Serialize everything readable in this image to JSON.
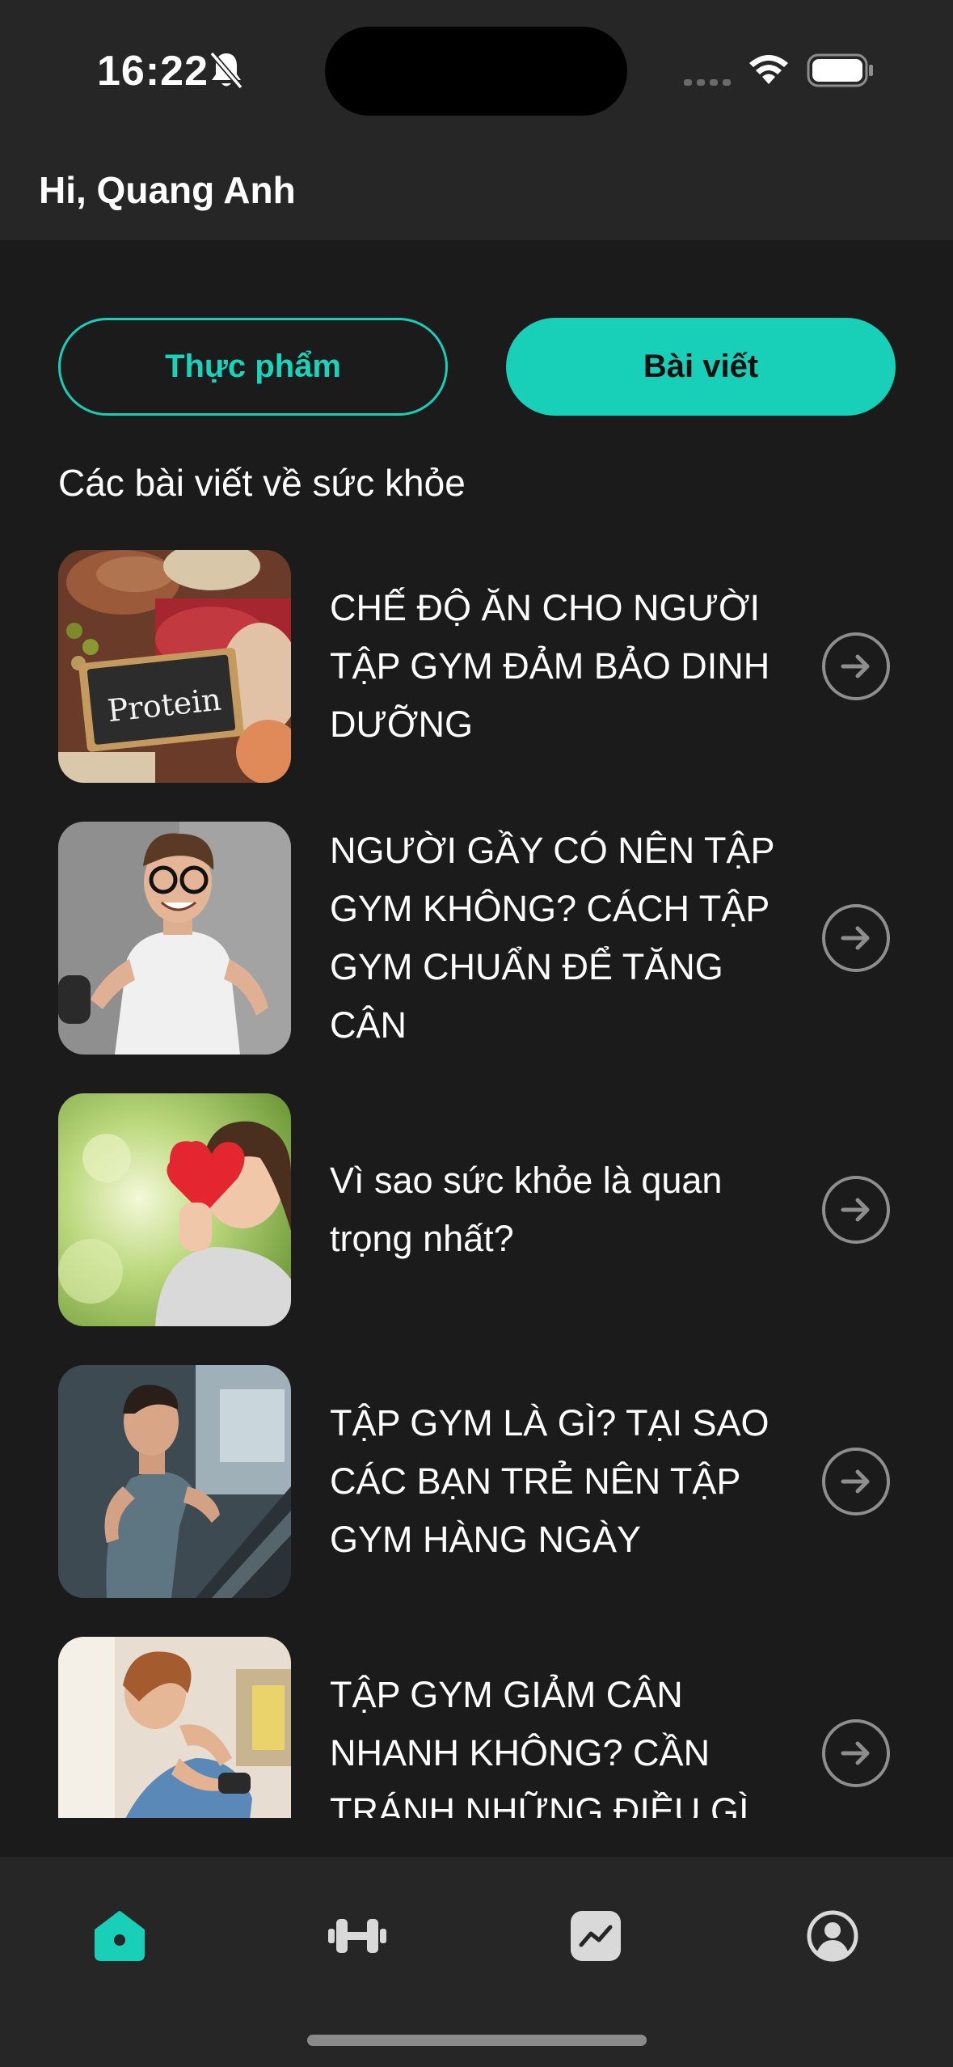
{
  "status_bar": {
    "time": "16:22"
  },
  "header": {
    "greeting": "Hi, Quang Anh"
  },
  "tabs": {
    "food_label": "Thực phẩm",
    "articles_label": "Bài viết",
    "active": "articles"
  },
  "section": {
    "title": "Các bài viết về sức khỏe"
  },
  "articles": [
    {
      "title": "CHẾ ĐỘ ĂN CHO NGƯỜI TẬP GYM ĐẢM BẢO DINH DƯỠNG",
      "thumb_text": "Protein"
    },
    {
      "title": "NGƯỜI GẦY CÓ NÊN TẬP GYM KHÔNG? CÁCH TẬP GYM CHUẨN ĐỂ TĂNG CÂN"
    },
    {
      "title": "Vì sao sức khỏe là quan trọng nhất?"
    },
    {
      "title": "TẬP GYM LÀ GÌ? TẠI SAO CÁC BẠN TRẺ NÊN TẬP GYM HÀNG NGÀY"
    },
    {
      "title": "TẬP GYM GIẢM CÂN NHANH KHÔNG? CẦN TRÁNH NHỮNG ĐIỀU GÌ"
    }
  ],
  "nav": [
    {
      "icon": "home-icon",
      "active": true
    },
    {
      "icon": "dumbbell-icon",
      "active": false
    },
    {
      "icon": "chart-icon",
      "active": false
    },
    {
      "icon": "profile-icon",
      "active": false
    }
  ],
  "colors": {
    "accent": "#18cfb8",
    "background": "#1b1b1b",
    "surface": "#262626",
    "icon_muted": "#d9d9d9"
  }
}
